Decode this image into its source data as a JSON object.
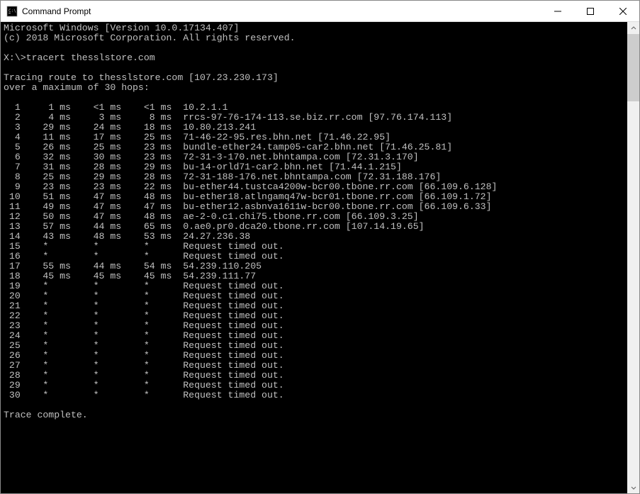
{
  "window": {
    "title": "Command Prompt"
  },
  "terminal": {
    "header1": "Microsoft Windows [Version 10.0.17134.407]",
    "header2": "(c) 2018 Microsoft Corporation. All rights reserved.",
    "prompt": "X:\\>",
    "command": "tracert thesslstore.com",
    "trace_line1": "Tracing route to thesslstore.com [107.23.230.173]",
    "trace_line2": "over a maximum of 30 hops:",
    "hops": [
      {
        "n": 1,
        "t1": "1 ms",
        "t2": "<1 ms",
        "t3": "<1 ms",
        "dest": "10.2.1.1"
      },
      {
        "n": 2,
        "t1": "4 ms",
        "t2": "3 ms",
        "t3": "8 ms",
        "dest": "rrcs-97-76-174-113.se.biz.rr.com [97.76.174.113]"
      },
      {
        "n": 3,
        "t1": "29 ms",
        "t2": "24 ms",
        "t3": "18 ms",
        "dest": "10.80.213.241"
      },
      {
        "n": 4,
        "t1": "11 ms",
        "t2": "17 ms",
        "t3": "25 ms",
        "dest": "71-46-22-95.res.bhn.net [71.46.22.95]"
      },
      {
        "n": 5,
        "t1": "26 ms",
        "t2": "25 ms",
        "t3": "23 ms",
        "dest": "bundle-ether24.tamp05-car2.bhn.net [71.46.25.81]"
      },
      {
        "n": 6,
        "t1": "32 ms",
        "t2": "30 ms",
        "t3": "23 ms",
        "dest": "72-31-3-170.net.bhntampa.com [72.31.3.170]"
      },
      {
        "n": 7,
        "t1": "31 ms",
        "t2": "28 ms",
        "t3": "29 ms",
        "dest": "bu-14-orld71-car2.bhn.net [71.44.1.215]"
      },
      {
        "n": 8,
        "t1": "25 ms",
        "t2": "29 ms",
        "t3": "28 ms",
        "dest": "72-31-188-176.net.bhntampa.com [72.31.188.176]"
      },
      {
        "n": 9,
        "t1": "23 ms",
        "t2": "23 ms",
        "t3": "22 ms",
        "dest": "bu-ether44.tustca4200w-bcr00.tbone.rr.com [66.109.6.128]"
      },
      {
        "n": 10,
        "t1": "51 ms",
        "t2": "47 ms",
        "t3": "48 ms",
        "dest": "bu-ether18.atlngamq47w-bcr01.tbone.rr.com [66.109.1.72]"
      },
      {
        "n": 11,
        "t1": "49 ms",
        "t2": "47 ms",
        "t3": "47 ms",
        "dest": "bu-ether12.asbnva1611w-bcr00.tbone.rr.com [66.109.6.33]"
      },
      {
        "n": 12,
        "t1": "50 ms",
        "t2": "47 ms",
        "t3": "48 ms",
        "dest": "ae-2-0.c1.chi75.tbone.rr.com [66.109.3.25]"
      },
      {
        "n": 13,
        "t1": "57 ms",
        "t2": "44 ms",
        "t3": "65 ms",
        "dest": "0.ae0.pr0.dca20.tbone.rr.com [107.14.19.65]"
      },
      {
        "n": 14,
        "t1": "43 ms",
        "t2": "48 ms",
        "t3": "53 ms",
        "dest": "24.27.236.38"
      },
      {
        "n": 15,
        "t1": "*",
        "t2": "*",
        "t3": "*",
        "dest": "Request timed out."
      },
      {
        "n": 16,
        "t1": "*",
        "t2": "*",
        "t3": "*",
        "dest": "Request timed out."
      },
      {
        "n": 17,
        "t1": "55 ms",
        "t2": "44 ms",
        "t3": "54 ms",
        "dest": "54.239.110.205"
      },
      {
        "n": 18,
        "t1": "45 ms",
        "t2": "45 ms",
        "t3": "45 ms",
        "dest": "54.239.111.77"
      },
      {
        "n": 19,
        "t1": "*",
        "t2": "*",
        "t3": "*",
        "dest": "Request timed out."
      },
      {
        "n": 20,
        "t1": "*",
        "t2": "*",
        "t3": "*",
        "dest": "Request timed out."
      },
      {
        "n": 21,
        "t1": "*",
        "t2": "*",
        "t3": "*",
        "dest": "Request timed out."
      },
      {
        "n": 22,
        "t1": "*",
        "t2": "*",
        "t3": "*",
        "dest": "Request timed out."
      },
      {
        "n": 23,
        "t1": "*",
        "t2": "*",
        "t3": "*",
        "dest": "Request timed out."
      },
      {
        "n": 24,
        "t1": "*",
        "t2": "*",
        "t3": "*",
        "dest": "Request timed out."
      },
      {
        "n": 25,
        "t1": "*",
        "t2": "*",
        "t3": "*",
        "dest": "Request timed out."
      },
      {
        "n": 26,
        "t1": "*",
        "t2": "*",
        "t3": "*",
        "dest": "Request timed out."
      },
      {
        "n": 27,
        "t1": "*",
        "t2": "*",
        "t3": "*",
        "dest": "Request timed out."
      },
      {
        "n": 28,
        "t1": "*",
        "t2": "*",
        "t3": "*",
        "dest": "Request timed out."
      },
      {
        "n": 29,
        "t1": "*",
        "t2": "*",
        "t3": "*",
        "dest": "Request timed out."
      },
      {
        "n": 30,
        "t1": "*",
        "t2": "*",
        "t3": "*",
        "dest": "Request timed out."
      }
    ],
    "complete": "Trace complete."
  }
}
